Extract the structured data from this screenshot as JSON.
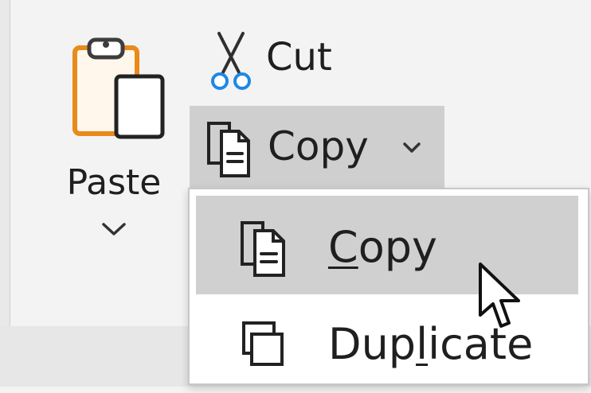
{
  "ribbon": {
    "paste": {
      "label": "Paste",
      "icon": "paste-clipboard-icon",
      "chevron_icon": "chevron-down-icon"
    },
    "cut": {
      "label": "Cut",
      "icon": "scissors-icon"
    },
    "copy_split": {
      "label": "Copy",
      "icon": "copy-documents-icon",
      "chevron_icon": "chevron-down-icon",
      "state": "hovered"
    }
  },
  "dropdown": {
    "items": [
      {
        "label": "Copy",
        "accelerator_letter": "C",
        "icon": "copy-documents-icon",
        "state": "hovered"
      },
      {
        "label": "Duplicate",
        "accelerator_letter": "l",
        "icon": "duplicate-icon",
        "state": "normal"
      }
    ]
  },
  "cursor": {
    "icon": "mouse-pointer-icon"
  },
  "colors": {
    "ribbon_background": "#f3f3f3",
    "hover_background": "#d0d0d0",
    "menu_background": "#ffffff",
    "paste_accent": "#e98a1a",
    "scissor_handle_accent": "#1e88e5",
    "text": "#1f1f1f"
  }
}
